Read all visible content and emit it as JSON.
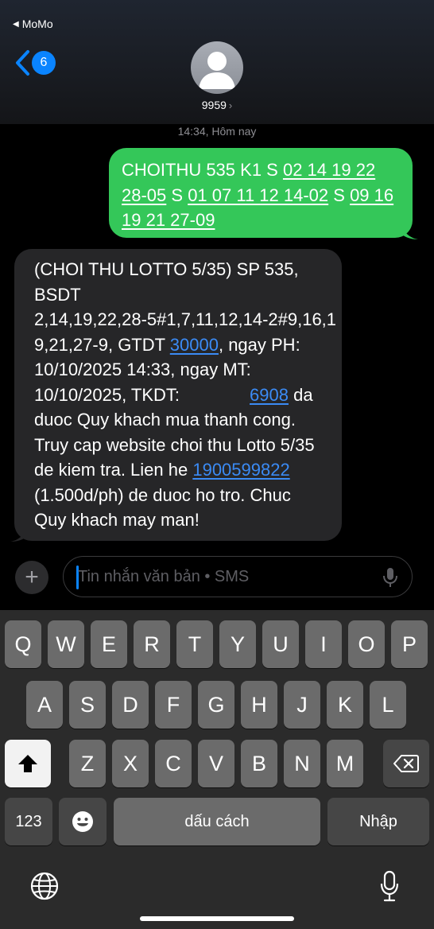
{
  "status": {
    "back_app": "MoMo"
  },
  "header": {
    "back_badge": "6",
    "contact": "9959",
    "contact_chevron": "›"
  },
  "thread": {
    "timestamp": "14:34, Hôm nay",
    "outgoing": {
      "l1_a": "CHOITHU 535 K1 S ",
      "l1_b": "02 14 19 22",
      "l2_a": "28-05",
      "l2_b": " S ",
      "l2_c": "01 07 11 12 14-02",
      "l2_d": " S ",
      "l2_e": "09 16",
      "l3_a": "19 21 27-09"
    },
    "incoming": {
      "l1": "(CHOI THU LOTTO 5/35) SP 535,",
      "l2": "BSDT",
      "l3": "2,14,19,22,28-5#1,7,11,12,14-2#9,16,1",
      "l4_a": "9,21,27-9, GTDT ",
      "l4_link": "30000",
      "l4_b": ", ngay PH:",
      "l5": "10/10/2025 14:33, ngay MT:",
      "l6_a": "10/10/2025, TKDT:",
      "l6_link": "6908",
      "l6_b": " da",
      "l7": "duoc Quy khach mua thanh cong.",
      "l8": "Truy cap website choi thu Lotto 5/35",
      "l9_a": "de kiem tra. Lien he ",
      "l9_link": "1900599822",
      "l10": "(1.500d/ph) de duoc ho tro. Chuc",
      "l11": "Quy khach may man!"
    }
  },
  "composer": {
    "plus": "+",
    "placeholder": "Tin nhắn văn bản • SMS"
  },
  "keyboard": {
    "row1": [
      "Q",
      "W",
      "E",
      "R",
      "T",
      "Y",
      "U",
      "I",
      "O",
      "P"
    ],
    "row2": [
      "A",
      "S",
      "D",
      "F",
      "G",
      "H",
      "J",
      "K",
      "L"
    ],
    "row3": [
      "Z",
      "X",
      "C",
      "V",
      "B",
      "N",
      "M"
    ],
    "numbers": "123",
    "space": "dấu cách",
    "return": "Nhập"
  },
  "icons": {
    "back": "chevron-left-icon",
    "avatar": "person-icon",
    "mic": "mic-icon",
    "shift": "shift-icon",
    "delete": "delete-icon",
    "emoji": "emoji-icon",
    "globe": "globe-icon"
  },
  "colors": {
    "outgoing_bubble": "#34c759",
    "incoming_bubble": "#262628",
    "link": "#3b8bf5",
    "accent": "#0a84ff"
  }
}
